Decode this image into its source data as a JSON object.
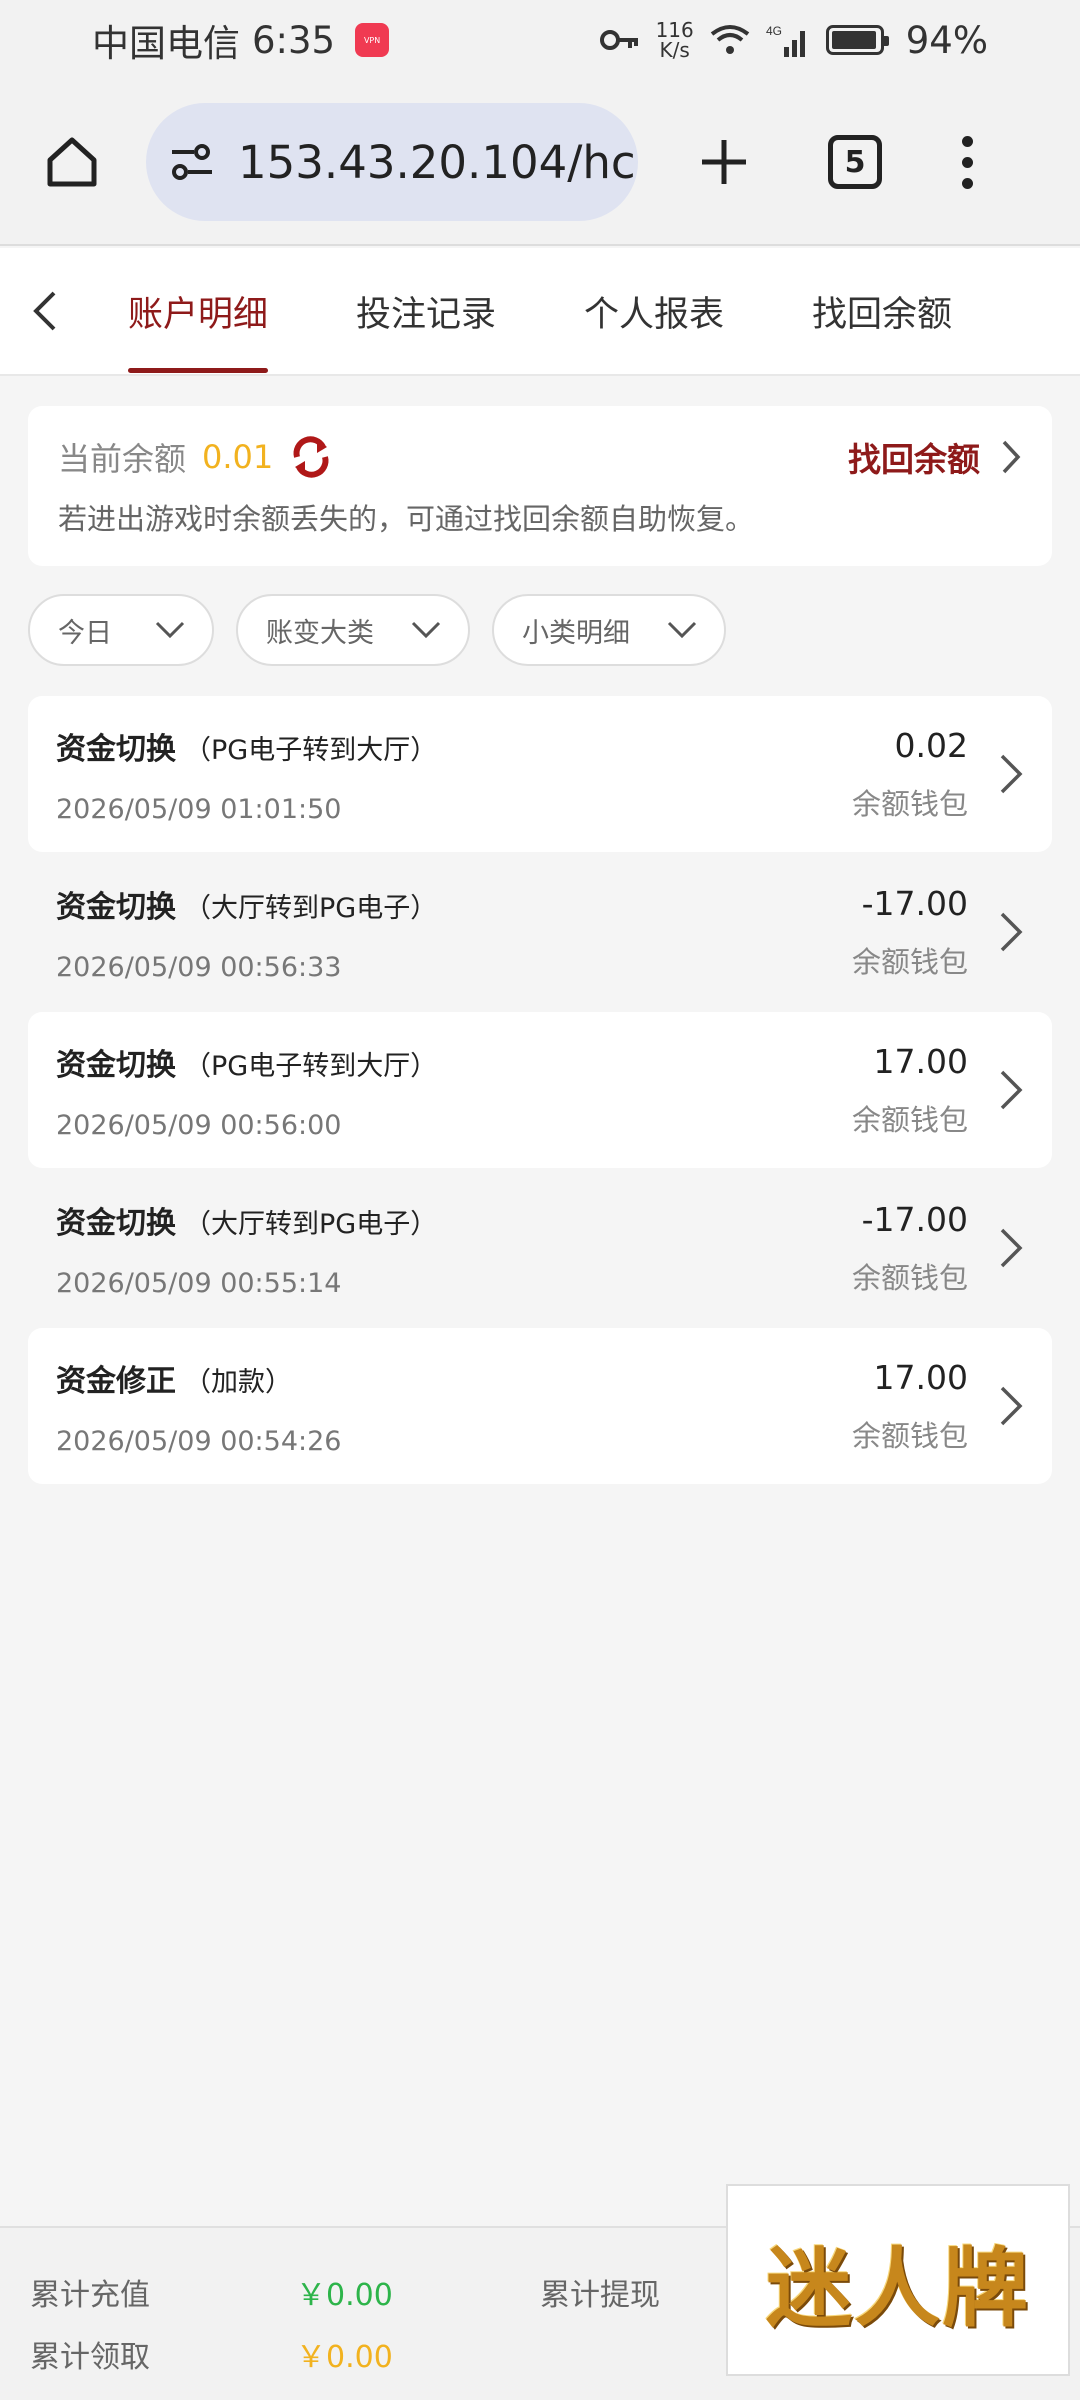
{
  "status_bar": {
    "carrier": "中国电信",
    "time": "6:35",
    "speed_value": "116",
    "speed_unit": "K/s",
    "network": "4G",
    "battery": "94%"
  },
  "browser": {
    "url": "153.43.20.104/hc",
    "tab_count": "5"
  },
  "tabs": [
    {
      "label": "账户明细",
      "active": true
    },
    {
      "label": "投注记录",
      "active": false
    },
    {
      "label": "个人报表",
      "active": false
    },
    {
      "label": "找回余额",
      "active": false
    }
  ],
  "balance": {
    "label": "当前余额",
    "value": "0.01",
    "recover_label": "找回余额",
    "hint": "若进出游戏时余额丢失的，可通过找回余额自助恢复。"
  },
  "filters": [
    {
      "label": "今日"
    },
    {
      "label": "账变大类"
    },
    {
      "label": "小类明细"
    }
  ],
  "records": [
    {
      "title": "资金切换",
      "sub": "（PG电子转到大厅）",
      "time": "2026/05/09 01:01:50",
      "amount": "0.02",
      "wallet": "余额钱包"
    },
    {
      "title": "资金切换",
      "sub": "（大厅转到PG电子）",
      "time": "2026/05/09 00:56:33",
      "amount": "-17.00",
      "wallet": "余额钱包"
    },
    {
      "title": "资金切换",
      "sub": "（PG电子转到大厅）",
      "time": "2026/05/09 00:56:00",
      "amount": "17.00",
      "wallet": "余额钱包"
    },
    {
      "title": "资金切换",
      "sub": "（大厅转到PG电子）",
      "time": "2026/05/09 00:55:14",
      "amount": "-17.00",
      "wallet": "余额钱包"
    },
    {
      "title": "资金修正",
      "sub": "（加款）",
      "time": "2026/05/09 00:54:26",
      "amount": "17.00",
      "wallet": "余额钱包"
    }
  ],
  "summary": {
    "deposit_label": "累计充值",
    "deposit_value": "￥0.00",
    "withdraw_label": "累计提现",
    "claim_label": "累计领取",
    "claim_value": "￥0.00"
  },
  "logo_text": "迷人牌",
  "colors": {
    "accent": "#8e1a1a",
    "balance": "#f2b21f",
    "deposit": "#2db44a",
    "claim": "#f2b21f"
  }
}
